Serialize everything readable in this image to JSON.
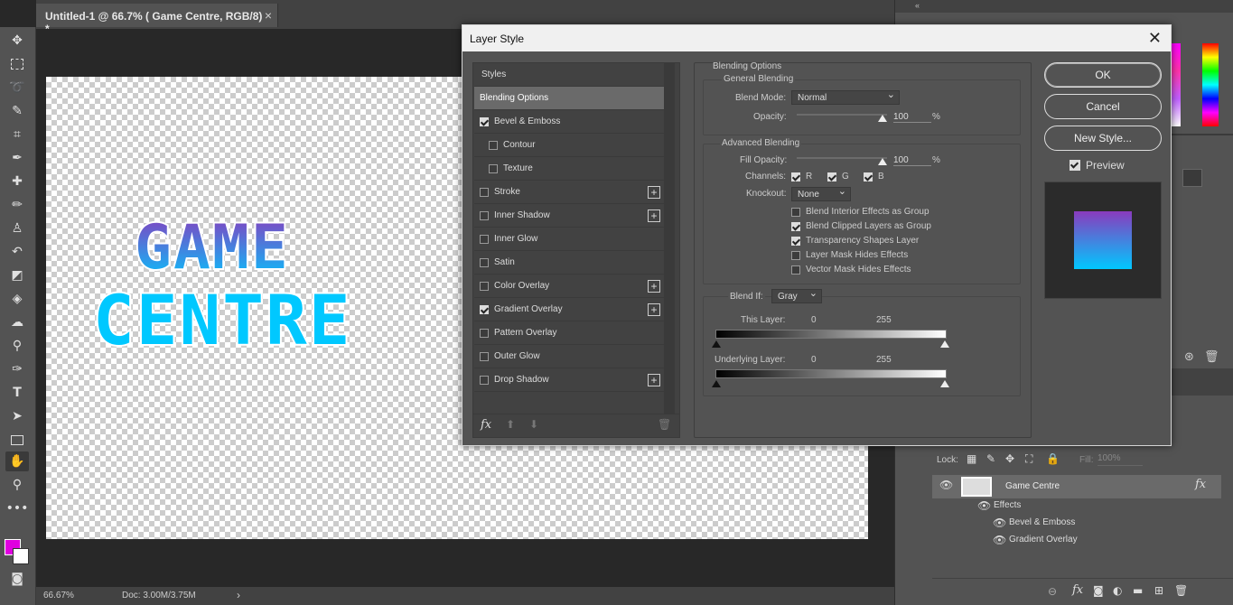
{
  "document": {
    "tab_title": "Untitled-1 @ 66.7% ( Game Centre, RGB/8) *",
    "close_glyph": "×",
    "canvas_text_line1": "GAME",
    "canvas_text_line2": "CENTRE"
  },
  "statusbar": {
    "zoom": "66.67%",
    "doc": "Doc: 3.00M/3.75M",
    "arrow": "›"
  },
  "dialog": {
    "title": "Layer Style",
    "close": "✕",
    "styles_header": "Styles",
    "styles": [
      {
        "label": "Blending Options",
        "checkbox": false,
        "checked": false,
        "plus": false,
        "selected": true,
        "indent": false
      },
      {
        "label": "Bevel & Emboss",
        "checkbox": true,
        "checked": true,
        "plus": false,
        "selected": false,
        "indent": false
      },
      {
        "label": "Contour",
        "checkbox": true,
        "checked": false,
        "plus": false,
        "selected": false,
        "indent": true
      },
      {
        "label": "Texture",
        "checkbox": true,
        "checked": false,
        "plus": false,
        "selected": false,
        "indent": true
      },
      {
        "label": "Stroke",
        "checkbox": true,
        "checked": false,
        "plus": true,
        "selected": false,
        "indent": false
      },
      {
        "label": "Inner Shadow",
        "checkbox": true,
        "checked": false,
        "plus": true,
        "selected": false,
        "indent": false
      },
      {
        "label": "Inner Glow",
        "checkbox": true,
        "checked": false,
        "plus": false,
        "selected": false,
        "indent": false
      },
      {
        "label": "Satin",
        "checkbox": true,
        "checked": false,
        "plus": false,
        "selected": false,
        "indent": false
      },
      {
        "label": "Color Overlay",
        "checkbox": true,
        "checked": false,
        "plus": true,
        "selected": false,
        "indent": false
      },
      {
        "label": "Gradient Overlay",
        "checkbox": true,
        "checked": true,
        "plus": true,
        "selected": false,
        "indent": false
      },
      {
        "label": "Pattern Overlay",
        "checkbox": true,
        "checked": false,
        "plus": false,
        "selected": false,
        "indent": false
      },
      {
        "label": "Outer Glow",
        "checkbox": true,
        "checked": false,
        "plus": false,
        "selected": false,
        "indent": false
      },
      {
        "label": "Drop Shadow",
        "checkbox": true,
        "checked": false,
        "plus": true,
        "selected": false,
        "indent": false
      }
    ],
    "fx_label": "fx",
    "blending": {
      "section": "Blending Options",
      "general": "General Blending",
      "blend_mode_label": "Blend Mode:",
      "blend_mode": "Normal",
      "opacity_label": "Opacity:",
      "opacity": "100",
      "percent": "%",
      "advanced": "Advanced Blending",
      "fill_opacity_label": "Fill Opacity:",
      "fill_opacity": "100",
      "channels_label": "Channels:",
      "channel_r": "R",
      "channel_g": "G",
      "channel_b": "B",
      "knockout_label": "Knockout:",
      "knockout": "None",
      "options": [
        {
          "label": "Blend Interior Effects as Group",
          "checked": false
        },
        {
          "label": "Blend Clipped Layers as Group",
          "checked": true
        },
        {
          "label": "Transparency Shapes Layer",
          "checked": true
        },
        {
          "label": "Layer Mask Hides Effects",
          "checked": false
        },
        {
          "label": "Vector Mask Hides Effects",
          "checked": false
        }
      ],
      "blend_if_label": "Blend If:",
      "blend_if": "Gray",
      "this_layer_label": "This Layer:",
      "this_low": "0",
      "this_high": "255",
      "underlying_label": "Underlying Layer:",
      "under_low": "0",
      "under_high": "255"
    },
    "buttons": {
      "ok": "OK",
      "cancel": "Cancel",
      "new_style": "New Style...",
      "preview": "Preview"
    }
  },
  "layers": {
    "lock_label": "Lock:",
    "fill_label": "Fill:",
    "fill_value": "100%",
    "layer_name": "Game Centre",
    "fx": "fx",
    "effects_label": "Effects",
    "effect_items": [
      "Bevel & Emboss",
      "Gradient Overlay"
    ]
  },
  "colors": {
    "foreground": "#e000e0",
    "background": "#ffffff",
    "gradient_top": "#8a3bbd",
    "gradient_bottom": "#00c8ff"
  }
}
